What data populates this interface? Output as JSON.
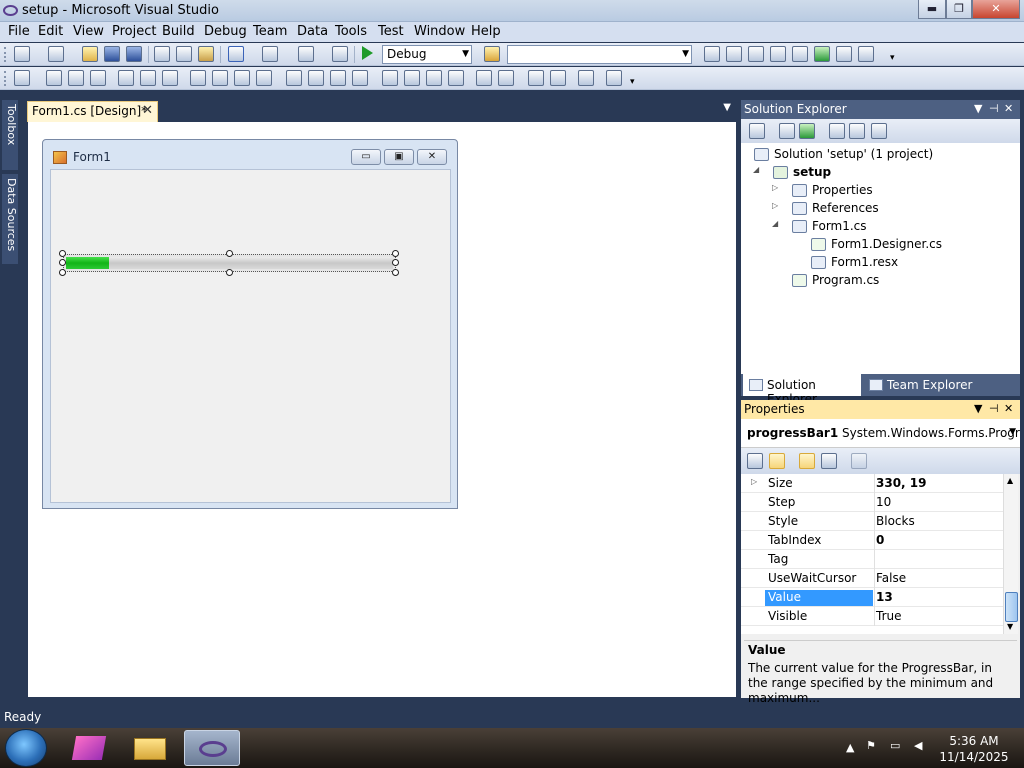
{
  "window": {
    "title": "setup - Microsoft Visual Studio",
    "minimize": "▬",
    "restore": "❐",
    "close": "✕"
  },
  "menu": [
    "File",
    "Edit",
    "View",
    "Project",
    "Build",
    "Debug",
    "Team",
    "Data",
    "Tools",
    "Test",
    "Window",
    "Help"
  ],
  "toolbar": {
    "config": "Debug",
    "platform": ""
  },
  "left_tabs": {
    "toolbox": "Toolbox",
    "data_sources": "Data Sources"
  },
  "doc_tab": {
    "label": "Form1.cs [Design]*",
    "close": "✕",
    "dropdown": "▼"
  },
  "form": {
    "caption": "Form1",
    "minimize": "▭",
    "maximize": "▣",
    "close": "✕"
  },
  "progress": {
    "value": 13,
    "max": 100
  },
  "solution_explorer": {
    "title": "Solution Explorer",
    "tree": [
      {
        "label": "Solution 'setup' (1 project)",
        "bold": false
      },
      {
        "label": "setup",
        "bold": true
      },
      {
        "label": "Properties"
      },
      {
        "label": "References"
      },
      {
        "label": "Form1.cs"
      },
      {
        "label": "Form1.Designer.cs"
      },
      {
        "label": "Form1.resx"
      },
      {
        "label": "Program.cs"
      }
    ],
    "tabs": [
      "Solution Explorer",
      "Team Explorer"
    ]
  },
  "properties": {
    "title": "Properties",
    "object_name": "progressBar1",
    "object_type": "System.Windows.Forms.Progress",
    "rows": [
      {
        "name": "Size",
        "value": "330, 19",
        "bold": true
      },
      {
        "name": "Step",
        "value": "10",
        "bold": false
      },
      {
        "name": "Style",
        "value": "Blocks",
        "bold": false
      },
      {
        "name": "TabIndex",
        "value": "0",
        "bold": true
      },
      {
        "name": "Tag",
        "value": "",
        "bold": false
      },
      {
        "name": "UseWaitCursor",
        "value": "False",
        "bold": false
      },
      {
        "name": "Value",
        "value": "13",
        "bold": true
      },
      {
        "name": "Visible",
        "value": "True",
        "bold": false
      }
    ],
    "desc_title": "Value",
    "desc_text": "The current value for the ProgressBar, in the range specified by the minimum and maximum..."
  },
  "status": "Ready",
  "clock": {
    "time": "5:36 AM",
    "date": "11/14/2025"
  }
}
